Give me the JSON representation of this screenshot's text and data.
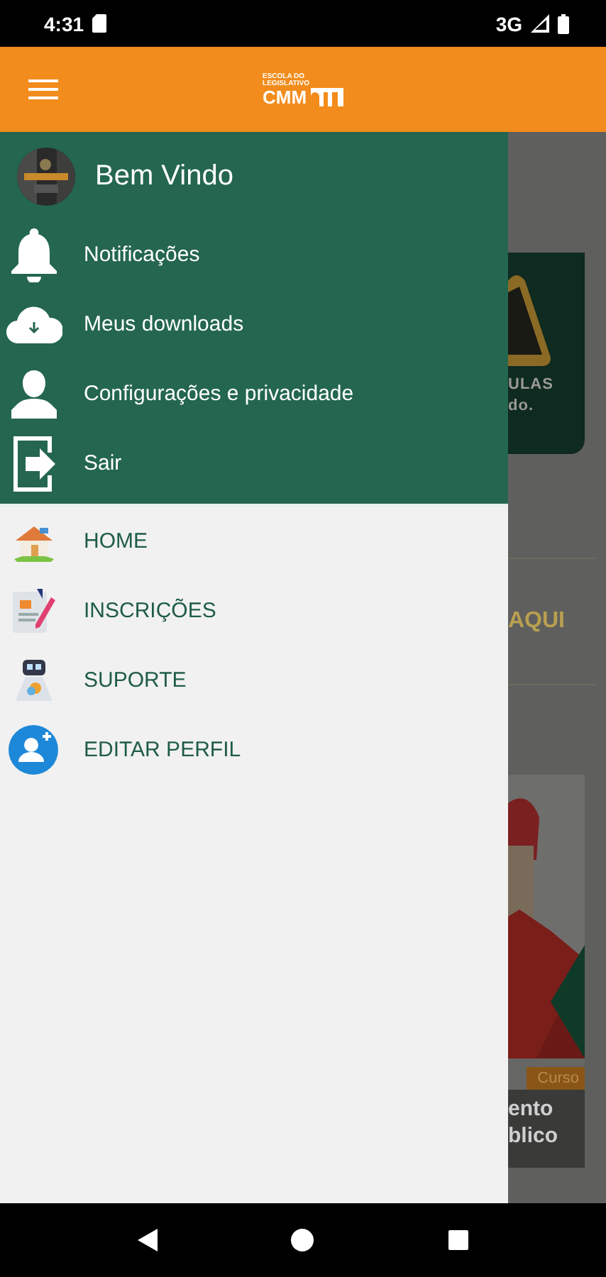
{
  "status_bar": {
    "time": "4:31",
    "network": "3G"
  },
  "app_bar": {
    "logo_lines": [
      "ESCOLA DO",
      "LEGISLATIVO"
    ],
    "logo_text": "CMM"
  },
  "drawer": {
    "greeting": "Bem Vindo",
    "account_items": [
      {
        "label": "Notificações"
      },
      {
        "label": "Meus downloads"
      },
      {
        "label": "Configurações e privacidade"
      },
      {
        "label": "Sair"
      }
    ],
    "menu_items": [
      {
        "label": "HOME"
      },
      {
        "label": "INSCRIÇÕES"
      },
      {
        "label": "SUPORTE"
      },
      {
        "label": "EDITAR PERFIL"
      }
    ]
  },
  "background": {
    "card_lines": [
      "ULAS",
      "do."
    ],
    "link": "AQUI",
    "course": {
      "badge": "Curso",
      "title_lines": [
        "ento",
        "blico"
      ]
    }
  }
}
